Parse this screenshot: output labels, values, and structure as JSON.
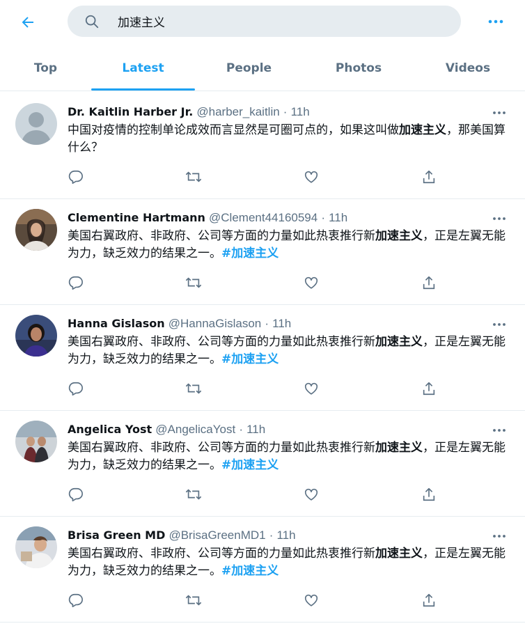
{
  "search": {
    "query": "加速主义"
  },
  "tabs": [
    {
      "label": "Top"
    },
    {
      "label": "Latest"
    },
    {
      "label": "People"
    },
    {
      "label": "Photos"
    },
    {
      "label": "Videos"
    }
  ],
  "colors": {
    "accent": "#1da1f2",
    "muted": "#5b7083",
    "text": "#0f1419",
    "divider": "#e6ecf0"
  },
  "tweets": [
    {
      "name": "Dr. Kaitlin Harber Jr.",
      "handle": "@harber_kaitlin",
      "sep": "·",
      "time": "11h",
      "avatar": "default-avatar",
      "text_before": "中国对疫情的控制单论成效而言显然是可圈可点的，如果这叫做",
      "text_bold": "加速主义",
      "text_after": "，那美国算什么？",
      "hashtag": ""
    },
    {
      "name": "Clementine Hartmann",
      "handle": "@Clement44160594",
      "sep": "·",
      "time": "11h",
      "avatar": "photo-avatar",
      "text_before": "美国右翼政府、非政府、公司等方面的力量如此热衷推行新",
      "text_bold": "加速主义",
      "text_after": "，正是左翼无能为力，缺乏效力的结果之一。",
      "hashtag": "#加速主义"
    },
    {
      "name": "Hanna Gislason",
      "handle": "@HannaGislason",
      "sep": "·",
      "time": "11h",
      "avatar": "photo-avatar",
      "text_before": "美国右翼政府、非政府、公司等方面的力量如此热衷推行新",
      "text_bold": "加速主义",
      "text_after": "，正是左翼无能为力，缺乏效力的结果之一。",
      "hashtag": "#加速主义"
    },
    {
      "name": "Angelica Yost",
      "handle": "@AngelicaYost",
      "sep": "·",
      "time": "11h",
      "avatar": "photo-avatar",
      "text_before": "美国右翼政府、非政府、公司等方面的力量如此热衷推行新",
      "text_bold": "加速主义",
      "text_after": "，正是左翼无能为力，缺乏效力的结果之一。",
      "hashtag": "#加速主义"
    },
    {
      "name": "Brisa Green MD",
      "handle": "@BrisaGreenMD1",
      "sep": "·",
      "time": "11h",
      "avatar": "photo-avatar",
      "text_before": "美国右翼政府、非政府、公司等方面的力量如此热衷推行新",
      "text_bold": "加速主义",
      "text_after": "，正是左翼无能为力，缺乏效力的结果之一。",
      "hashtag": "#加速主义"
    }
  ],
  "icons": {
    "back": "back-arrow-icon",
    "search": "search-icon",
    "more": "more-horizontal-icon",
    "reply": "reply-icon",
    "retweet": "retweet-icon",
    "like": "heart-icon",
    "share": "share-icon"
  }
}
